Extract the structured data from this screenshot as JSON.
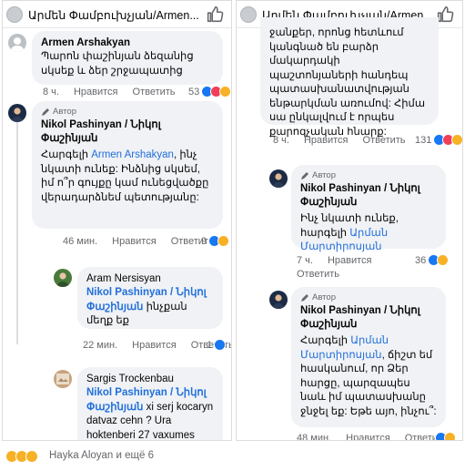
{
  "header": {
    "title": "Արմեն Փամբուխչյան/Armen..."
  },
  "left": {
    "c1": {
      "author": "Armen Arshakyan",
      "text": "Պարոն փաշինյան ձեզանից սկսեք և ձեր շրջապատից",
      "time": "8 ч.",
      "like": "Нравится",
      "reply": "Ответить",
      "count": "53"
    },
    "c2": {
      "badge": "Автор",
      "author": "Nikol Pashinyan / Նիկոլ Փաշինյան",
      "pre": "Հարգելի ",
      "mention": "Armen Arshakyan",
      "text": ", ինչ նկատի ունեք: Ինձնից սկսեմ, իմ ո՞ր գույքը կամ ունեցվածքը վերադարձնեմ պետությանը:",
      "time": "46 мин.",
      "like": "Нравится",
      "reply": "Ответить",
      "count": "9"
    },
    "c3": {
      "author": "Aram Nersisyan",
      "mention": "Nikol Pashinyan / Նիկոլ Փաշինյան",
      "text": " ինչքան մեղք եք",
      "time": "22 мин.",
      "like": "Нравится",
      "reply": "Ответить",
      "count": "1"
    },
    "c4": {
      "author": "Sargis Trockenbau",
      "mention": "Nikol Pashinyan / Նիկոլ Փաշինյան",
      "text": " xi serj kocaryn datvaz cehn ? Ura hoktenberi 27 vaxumes"
    }
  },
  "right": {
    "c1": {
      "text": "ջանքեր, որոնց հետևում կանգնած են բարձր մակարդակի պաշտոնյաների հանդեպ պատասխանատվության ենթարկման առումով: Հիմա սա ընկալվում է որպես քարոզչական հնարք:",
      "time": "8 ч.",
      "like": "Нравится",
      "reply": "Ответить",
      "count": "131"
    },
    "c2": {
      "badge": "Автор",
      "author": "Nikol Pashinyan / Նիկոլ Փաշինյան",
      "pre": "Ինչ նկատի ունեք, հարգելի ",
      "mention": "Արման Մարտիրոսյան",
      "time": "7 ч.",
      "like": "Нравится",
      "reply": "Ответить",
      "count": "36"
    },
    "c3": {
      "badge": "Автор",
      "author": "Nikol Pashinyan / Նիկոլ Փաշինյան",
      "pre": "Հարգելի ",
      "mention": "Արման Մարտիրոսյան",
      "text": ", ճիշտ եմ հասկանում, որ Ձեր հարցը, պարզապես նաև իմ պատասխանը ջնջել եք: Եթե այո, ինչու՞:",
      "time": "48 мин.",
      "like": "Нравится",
      "reply": "Ответить"
    }
  },
  "footer": {
    "text": "Hayka Aloyan и ещё 6"
  },
  "colors": {
    "mention": "#216fdb",
    "bubble": "#f0f2f5",
    "meta": "#65676b"
  },
  "icons": [
    "thumbs-up-icon",
    "like-reaction-icon",
    "love-reaction-icon",
    "haha-reaction-icon",
    "author-badge-icon"
  ]
}
